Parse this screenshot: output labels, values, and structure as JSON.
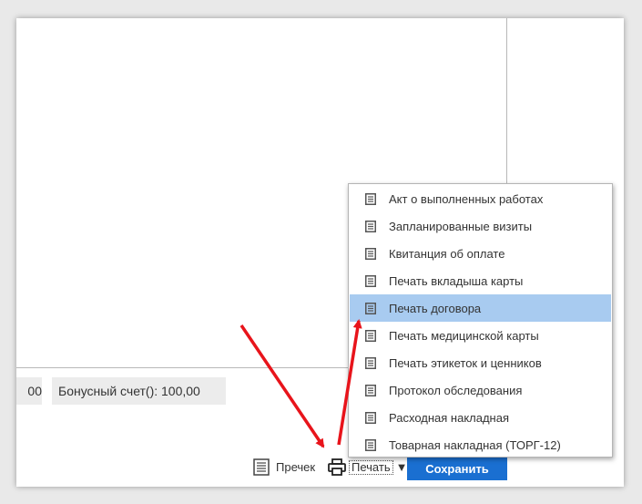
{
  "fields": {
    "left_value": "00",
    "bonus": "Бонусный счет(): 100,00"
  },
  "toolbar": {
    "receipt_label": "Пречек",
    "print_label": "Печать",
    "save_label": "Сохранить"
  },
  "print_menu": {
    "items": [
      {
        "label": "Акт о выполненных работах"
      },
      {
        "label": "Запланированные визиты"
      },
      {
        "label": "Квитанция об оплате"
      },
      {
        "label": "Печать вкладыша карты"
      },
      {
        "label": "Печать договора"
      },
      {
        "label": "Печать медицинской карты"
      },
      {
        "label": "Печать этикеток и ценников"
      },
      {
        "label": "Протокол обследования"
      },
      {
        "label": "Расходная накладная"
      },
      {
        "label": "Товарная накладная (ТОРГ-12)"
      }
    ],
    "highlighted_item": "Печать договора"
  },
  "colors": {
    "save_button": "#1a6fd1",
    "menu_highlight": "#a8cbf0",
    "annotation_arrow": "#e8141b"
  }
}
